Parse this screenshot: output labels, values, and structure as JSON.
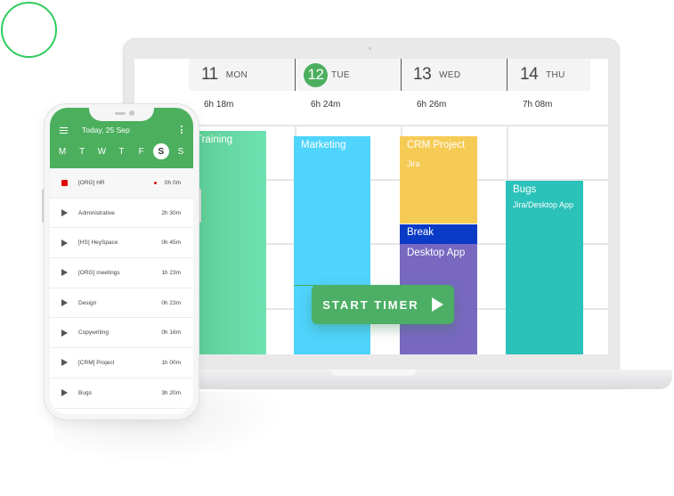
{
  "calendar": {
    "days": [
      {
        "num": "11",
        "name": "MON",
        "total": "6h 18m",
        "today": false
      },
      {
        "num": "12",
        "name": "TUE",
        "total": "6h 24m",
        "today": true
      },
      {
        "num": "13",
        "name": "WED",
        "total": "6h 26m",
        "today": false
      },
      {
        "num": "14",
        "name": "THU",
        "total": "7h 08m",
        "today": false
      }
    ],
    "events": {
      "training": {
        "title": "Training",
        "color": "#66dcab"
      },
      "marketing": {
        "title": "Marketing",
        "color": "#4fd4fd"
      },
      "crm": {
        "title": "CRM Project",
        "sub": "Jira",
        "color": "#f6cb55"
      },
      "break": {
        "title": "Break",
        "color": "#0a3bc7"
      },
      "desktop": {
        "title": "Desktop App",
        "color": "#7868c0"
      },
      "bugs": {
        "title": "Bugs",
        "sub": "Jira/Desktop App",
        "color": "#2bc2b9"
      }
    },
    "start_timer_label": "START TIMER"
  },
  "phone": {
    "date_label": "Today, 25 Sep",
    "weekdays": [
      "M",
      "T",
      "W",
      "T",
      "F",
      "S",
      "S"
    ],
    "active_weekday_index": 5,
    "tasks": [
      {
        "name": "[ORG] HR",
        "time": "0h 0m",
        "running": true
      },
      {
        "name": "Administrative",
        "time": "2h 30m",
        "running": false
      },
      {
        "name": "[HS] HeySpace",
        "time": "0h 45m",
        "running": false
      },
      {
        "name": "[ORG] meetings",
        "time": "1h 23m",
        "running": false
      },
      {
        "name": "Design",
        "time": "0h 23m",
        "running": false
      },
      {
        "name": "Copywriting",
        "time": "0h 16m",
        "running": false
      },
      {
        "name": "[CRM] Project",
        "time": "1h 00m",
        "running": false
      },
      {
        "name": "Bugs",
        "time": "3h 20m",
        "running": false
      }
    ]
  },
  "colors": {
    "accent_green": "#4caf5e",
    "stop_red": "#e00b0b",
    "deco_circle": "#2ecc5e"
  }
}
